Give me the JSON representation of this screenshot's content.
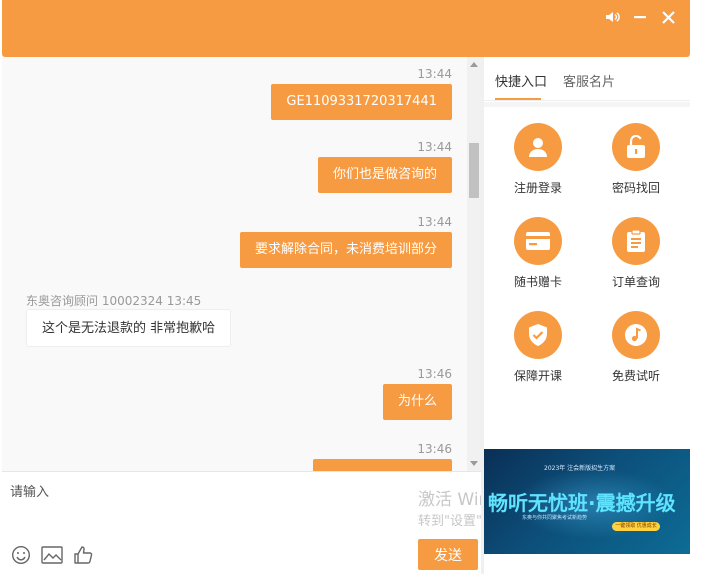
{
  "window": {
    "controls": [
      {
        "name": "volume",
        "icon": "speaker-icon"
      },
      {
        "name": "minimize",
        "icon": "minimize-icon"
      },
      {
        "name": "close",
        "icon": "close-icon"
      }
    ]
  },
  "chat": {
    "messages": [
      {
        "direction": "out",
        "time": "13:44",
        "text": "GE1109331720317441"
      },
      {
        "direction": "out",
        "time": "13:44",
        "text": "你们也是做咨询的"
      },
      {
        "direction": "out",
        "time": "13:44",
        "text": "要求解除合同，未消费培训部分"
      },
      {
        "direction": "in",
        "sender": "东奥咨询顾问 10002324 13:45",
        "text": "这个是无法退款的 非常抱歉哈"
      },
      {
        "direction": "out",
        "time": "13:46",
        "text": "为什么"
      },
      {
        "direction": "out",
        "time": "13:46",
        "text": ""
      }
    ]
  },
  "input": {
    "placeholder": "请输入",
    "tools": [
      "emoji-icon",
      "image-icon",
      "thumbs-up-icon"
    ],
    "send_label": "发送"
  },
  "watermark": {
    "line1": "激活 Windows",
    "line2": "转到\"设置\"以激活 Windows"
  },
  "sidebar": {
    "tabs": [
      {
        "label": "快捷入口",
        "active": true
      },
      {
        "label": "客服名片",
        "active": false
      }
    ],
    "shortcuts": [
      {
        "label": "注册登录",
        "icon": "user-icon"
      },
      {
        "label": "密码找回",
        "icon": "unlock-icon"
      },
      {
        "label": "随书赠卡",
        "icon": "card-icon"
      },
      {
        "label": "订单查询",
        "icon": "clipboard-icon"
      },
      {
        "label": "保障开课",
        "icon": "shield-check-icon"
      },
      {
        "label": "免费试听",
        "icon": "music-note-icon"
      }
    ],
    "banner": {
      "top_text": "2023年 注会新版招生方案",
      "main_text": "畅听无忧班·震撼升级",
      "sub_text": "东奥与你共同聚焦考试新趋势",
      "pill_text": "一键领取 优惠成长"
    }
  },
  "colors": {
    "accent": "#f79b43",
    "background": "#f9f9f9",
    "banner_bg": "#0c4f7a"
  }
}
